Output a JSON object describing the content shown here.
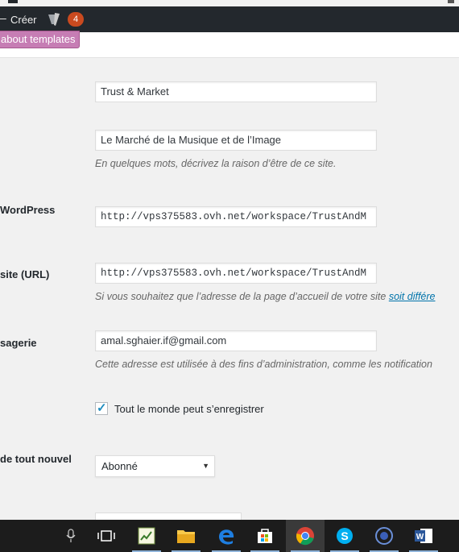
{
  "admin_bar": {
    "new_label": "Créer",
    "notification_count": "4"
  },
  "notice_button": {
    "label": "about templates"
  },
  "form": {
    "site_title": {
      "value": "Trust & Market"
    },
    "tagline": {
      "value": "Le Marché de la Musique et de l’Image",
      "description": "En quelques mots, décrivez la raison d’être de ce site."
    },
    "wordpress_address": {
      "label": "WordPress",
      "value": "http://vps375583.ovh.net/workspace/TrustAndM"
    },
    "site_address": {
      "label": "site (URL)",
      "value": "http://vps375583.ovh.net/workspace/TrustAndM",
      "description": "Si vous souhaitez que l’adresse de la page d’accueil de votre site ",
      "link": "soit différe"
    },
    "admin_email": {
      "label": "sagerie",
      "value": "amal.sghaier.if@gmail.com",
      "description": "Cette adresse est utilisée à des fins d’administration, comme les notification"
    },
    "membership": {
      "checked": true,
      "label": "Tout le monde peut s’enregistrer"
    },
    "default_role": {
      "label": "de tout nouvel",
      "selected": "Abonné"
    }
  },
  "taskbar": {
    "icons": [
      "microphone-icon",
      "task-view-icon",
      "tasks-app-icon",
      "file-explorer-icon",
      "edge-icon",
      "store-icon",
      "chrome-icon",
      "skype-icon",
      "app-icon",
      "word-icon"
    ],
    "active": "chrome-icon"
  },
  "colors": {
    "admin_bar": "#23282d",
    "badge": "#ca4a1f",
    "notice_button": "#c67db4",
    "link": "#0073aa",
    "checkbox_tick": "#1e8cbe",
    "taskbar": "#1c1c1c"
  }
}
